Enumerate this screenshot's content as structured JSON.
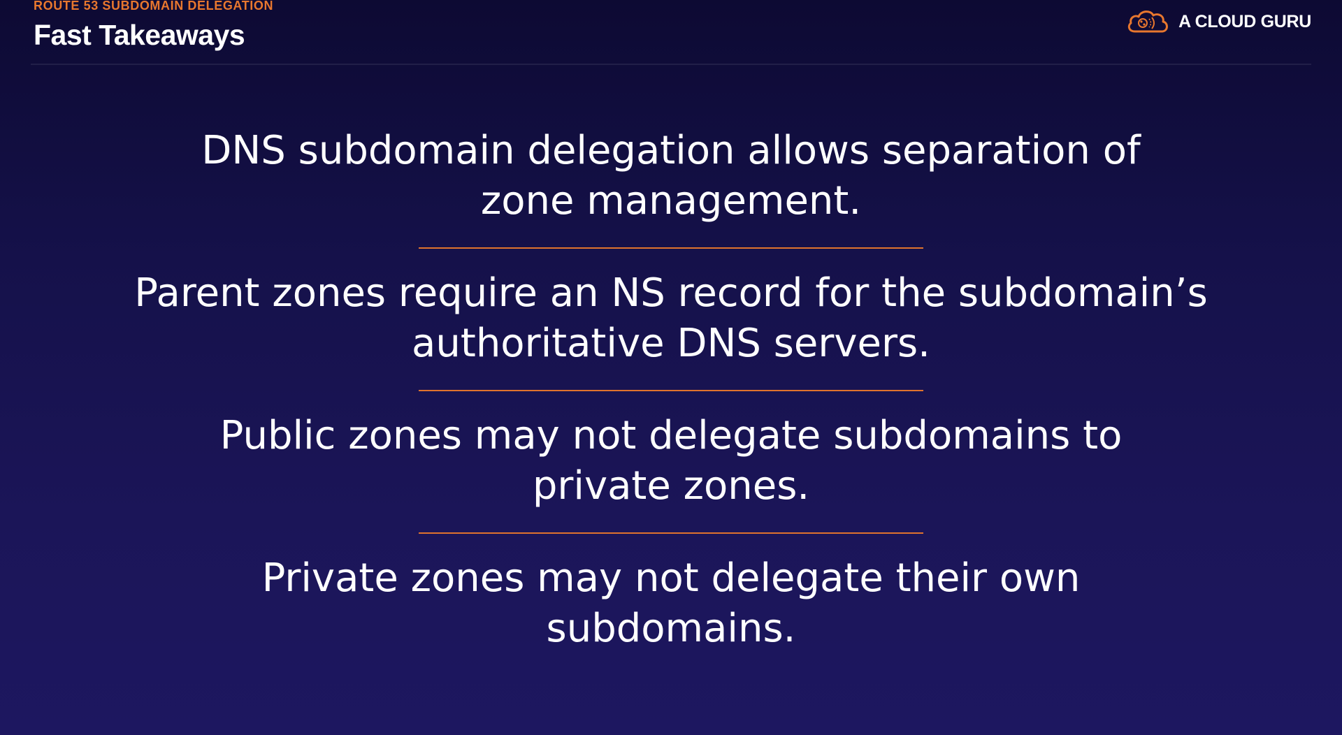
{
  "header": {
    "eyebrow": "ROUTE 53 SUBDOMAIN DELEGATION",
    "title": "Fast Takeaways"
  },
  "brand": {
    "name": "A CLOUD GURU",
    "logo_icon": "cloud-logo-icon",
    "accent_color": "#e8772e"
  },
  "takeaways": [
    {
      "text": "DNS subdomain delegation allows separation of\nzone management."
    },
    {
      "text": "Parent zones require an NS record for the subdomain’s\nauthoritative DNS servers."
    },
    {
      "text": "Public zones may not delegate subdomains to\nprivate zones."
    },
    {
      "text": "Private zones may not delegate their own\nsubdomains."
    }
  ],
  "colors": {
    "background_top": "#0d0a33",
    "background_bottom": "#1d1760",
    "divider": "#e0732d",
    "text": "#ffffff"
  }
}
